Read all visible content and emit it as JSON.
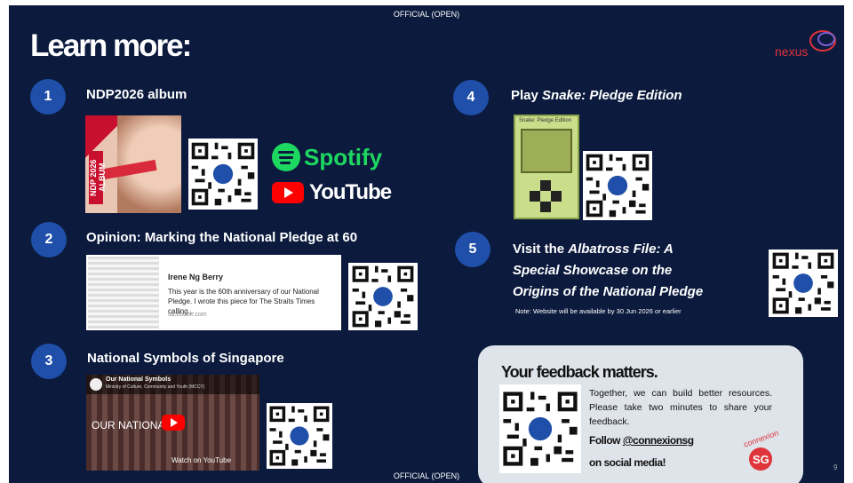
{
  "classification": "OFFICIAL (OPEN)",
  "title": "Learn more:",
  "logo": "nexus",
  "page_number": "9",
  "items": [
    {
      "num": "1",
      "heading": "NDP2026 album",
      "album_tag": "NDP 2026 ALBUM",
      "spotify": "Spotify",
      "youtube": "YouTube"
    },
    {
      "num": "2",
      "heading": "Opinion: Marking the National Pledge at 60",
      "card_name": "Irene Ng Berry",
      "card_desc": "This year is the 60th anniversary of our National Pledge. I wrote this piece for The Straits Times calling...",
      "card_source": "facebook.com"
    },
    {
      "num": "3",
      "heading": "National Symbols of Singapore",
      "video_title": "Our National Symbols",
      "video_sub": "Ministry of Culture, Community and Youth (MCCY)",
      "video_big": "OUR NATIONAL",
      "video_watch": "Watch on YouTube"
    },
    {
      "num": "4",
      "heading_plain": "Play ",
      "heading_italic": "Snake: Pledge Edition",
      "snake_caption": "Snake: Pledge Edition"
    },
    {
      "num": "5",
      "heading_plain": "Visit the ",
      "heading_italic_1": "Albatross File: A",
      "heading_italic_2": "Special Showcase on the",
      "heading_italic_3": "Origins of the National Pledge",
      "note": "Note: Website will be available by 30 Jun 2026 or earlier"
    }
  ],
  "feedback": {
    "heading": "Your feedback matters.",
    "text": "Together, we can build better resources. Please take two minutes to share your feedback.",
    "follow_prefix": "Follow ",
    "follow_handle": "@connexionsg",
    "follow_suffix": "on social media!",
    "badge_top": "connexion",
    "badge_bottom": "SG"
  },
  "colors": {
    "background": "#0b1a3d",
    "badge": "#1f4fa8",
    "spotify": "#1ed760",
    "youtube": "#ff0000",
    "accent_red": "#e0343b"
  }
}
